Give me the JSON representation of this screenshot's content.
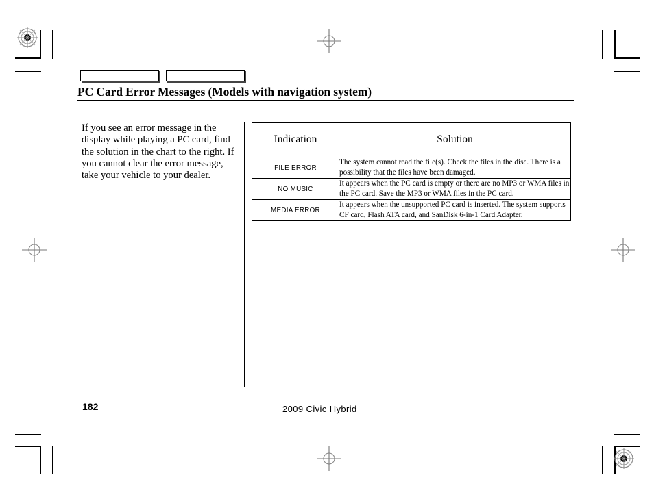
{
  "document": {
    "title": "PC Card Error Messages (Models with navigation system)",
    "intro_paragraph": "If you see an error message in the display while playing a PC card, find the solution in the chart to the right. If you cannot clear the error message, take your vehicle to your dealer.",
    "tab_boxes": [
      {
        "label": ""
      },
      {
        "label": ""
      }
    ],
    "table": {
      "headers": {
        "indication": "Indication",
        "solution": "Solution"
      },
      "rows": [
        {
          "indication": "FILE ERROR",
          "solution": "The system cannot read the file(s). Check the files in the disc. There is a possibility that the files have been damaged."
        },
        {
          "indication": "NO MUSIC",
          "solution": "It appears when the PC card is empty or there are no MP3 or WMA files in the PC card. Save the MP3 or WMA files in the PC card."
        },
        {
          "indication": "MEDIA ERROR",
          "solution": "It appears when the unsupported PC card is inserted. The system supports CF card, Flash ATA card, and SanDisk 6-in-1 Card Adapter."
        }
      ]
    },
    "footer": {
      "page_number": "182",
      "model_year": "2009  Civic  Hybrid"
    },
    "colors": {
      "ink": "#000000",
      "paper": "#ffffff",
      "registration_mark": "#777777"
    }
  }
}
